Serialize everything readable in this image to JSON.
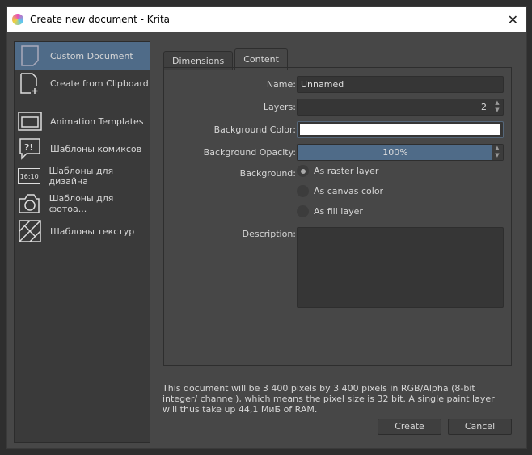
{
  "window": {
    "title": "Create new document - Krita"
  },
  "sidebar": {
    "items": [
      {
        "label": "Custom Document",
        "icon": "document-icon",
        "selected": true
      },
      {
        "label": "Create from Clipboard",
        "icon": "clipboard-new-icon"
      },
      {
        "label": "Animation Templates",
        "icon": "animation-icon"
      },
      {
        "label": "Шаблоны комиксов",
        "icon": "comic-bubble-icon"
      },
      {
        "label": "Шаблоны для дизайна",
        "icon": "ratio-16-10-icon",
        "icon_text": "16:10"
      },
      {
        "label": "Шаблоны для фотоа...",
        "icon": "camera-icon"
      },
      {
        "label": "Шаблоны текстур",
        "icon": "texture-icon"
      }
    ]
  },
  "tabs": [
    {
      "label": "Dimensions"
    },
    {
      "label": "Content",
      "active": true
    }
  ],
  "content": {
    "name_label": "Name:",
    "name_value": "Unnamed",
    "layers_label": "Layers:",
    "layers_value": "2",
    "bgcolor_label": "Background Color:",
    "bgcolor_value": "#ffffff",
    "opacity_label": "Background Opacity:",
    "opacity_value": "100%",
    "background_label": "Background:",
    "radios": [
      {
        "label": "As raster layer",
        "checked": true
      },
      {
        "label": "As canvas color"
      },
      {
        "label": "As fill layer"
      }
    ],
    "description_label": "Description:",
    "description_value": ""
  },
  "info": "This document will be 3 400 pixels by 3 400 pixels in RGB/Alpha (8-bit integer/ channel), which means the pixel size is 32 bit. A single paint layer will thus take up 44,1 МиБ of RAM.",
  "buttons": {
    "create": "Create",
    "cancel": "Cancel"
  },
  "colors": {
    "accent": "#4f6b88",
    "background": "#474747"
  }
}
